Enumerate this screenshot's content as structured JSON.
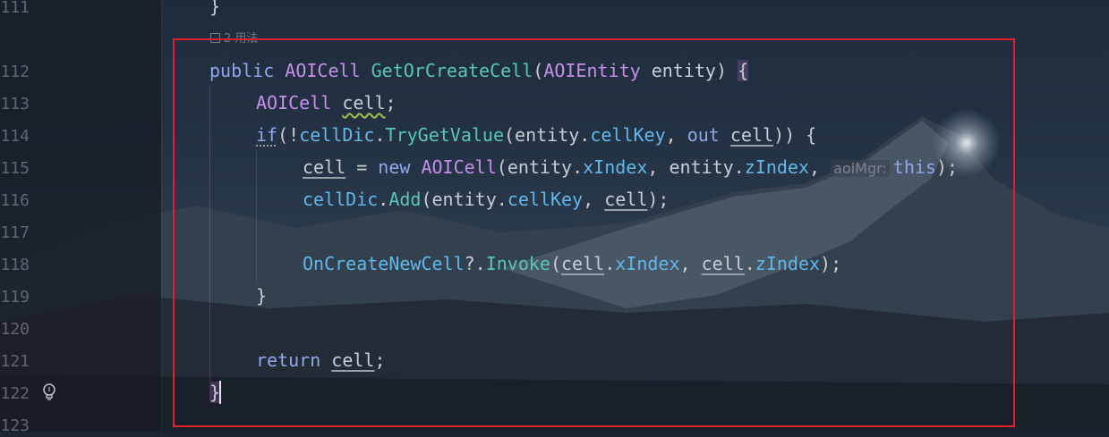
{
  "gutter": {
    "line_numbers": [
      "111",
      "112",
      "113",
      "114",
      "115",
      "116",
      "117",
      "118",
      "119",
      "120",
      "121",
      "122",
      "123"
    ]
  },
  "usages": {
    "label": "2 用法"
  },
  "code": {
    "line_111_text": "}",
    "kw_public": "public",
    "type_aoicell": "AOICell",
    "method_getorcreatecell": "GetOrCreateCell",
    "paren_open": "(",
    "type_aoientity": "AOIEntity",
    "param_entity": " entity",
    "paren_close_brace": ") ",
    "brace_open": "{",
    "var_cell": "cell",
    "semicolon": ";",
    "kw_if": "if",
    "not_op": "(!",
    "field_celldic": "cellDic",
    "dot": ".",
    "method_trygetvalue": "TryGetValue",
    "entity": "entity",
    "field_cellkey": "cellKey",
    "comma": ", ",
    "kw_out": "out",
    "close_if": ")) {",
    "assign": " = ",
    "kw_new": "new",
    "field_xindex": "xIndex",
    "field_zindex": "zIndex",
    "hint_aoimgr": "aoiMgr:",
    "kw_this": "this",
    "close_call": ");",
    "method_add": "Add",
    "event_oncreatenewcell": "OnCreateNewCell",
    "null_cond": "?.",
    "method_invoke": "Invoke",
    "brace_close": "}",
    "kw_return": "return"
  }
}
